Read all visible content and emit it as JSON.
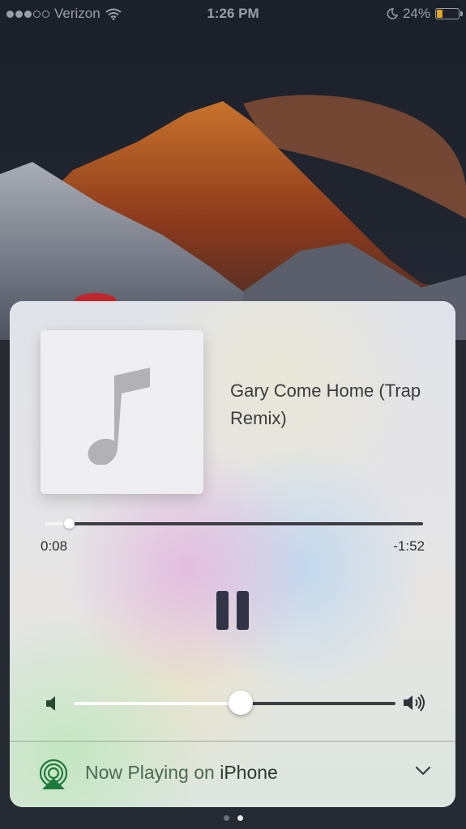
{
  "status_bar": {
    "carrier": "Verizon",
    "time": "1:26 PM",
    "battery_percent": "24%",
    "battery_level": 0.24,
    "signal_bars_filled": 3,
    "signal_bars_total": 5
  },
  "now_playing": {
    "title": "Gary Come Home (Trap Remix)",
    "elapsed": "0:08",
    "remaining": "-1:52",
    "progress": 0.067,
    "playback_state": "playing"
  },
  "volume": {
    "level": 0.52
  },
  "airplay": {
    "label_prefix": "Now Playing on",
    "device": "iPhone"
  },
  "pager": {
    "count": 2,
    "active_index": 1
  },
  "colors": {
    "airplay_accent": "#1e7a3c",
    "battery": "#e3a520",
    "pause_button": "#303446"
  },
  "icons": {
    "artwork": "music-note-icon",
    "pause": "pause-icon",
    "volume_low": "speaker-low-icon",
    "volume_high": "speaker-high-icon",
    "airplay": "airplay-icon",
    "chevron": "chevron-down-icon",
    "wifi": "wifi-icon",
    "moon": "do-not-disturb-icon"
  }
}
